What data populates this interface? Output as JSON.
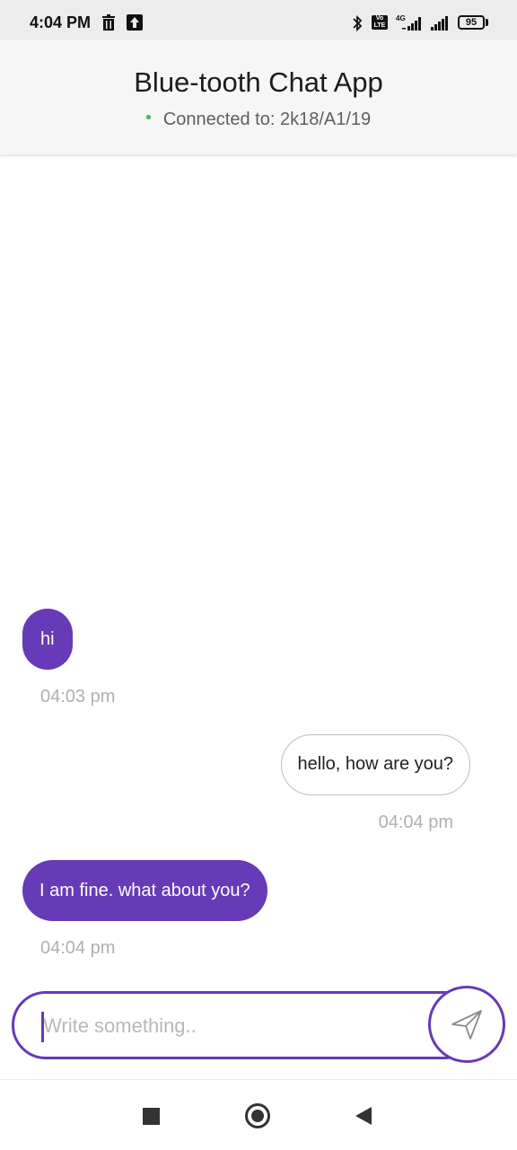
{
  "status_bar": {
    "time": "4:04 PM",
    "network": "4G",
    "volte": "Vo LTE",
    "battery": "95",
    "icons": [
      "trash-icon",
      "upload-icon",
      "bluetooth-icon",
      "volte-icon",
      "signal-icon",
      "battery-icon"
    ]
  },
  "header": {
    "title": "Blue-tooth Chat App",
    "connection_status": "Connected to: 2k18/A1/19",
    "status_color": "#3cba54"
  },
  "messages": [
    {
      "direction": "incoming",
      "text": "hi",
      "time": "04:03 pm"
    },
    {
      "direction": "outgoing",
      "text": "hello, how are you?",
      "time": "04:04 pm"
    },
    {
      "direction": "incoming",
      "text": "I am fine. what about you?",
      "time": "04:04 pm"
    }
  ],
  "composer": {
    "placeholder": "Write something..",
    "value": "",
    "send_icon": "send-icon"
  },
  "colors": {
    "accent": "#673ab7",
    "incoming_bubble": "#673ab7",
    "outgoing_bubble_border": "#bdbdbd",
    "timestamp": "#b0b0b0"
  },
  "nav_bar": {
    "icons": [
      "recents-icon",
      "home-icon",
      "back-icon"
    ]
  }
}
